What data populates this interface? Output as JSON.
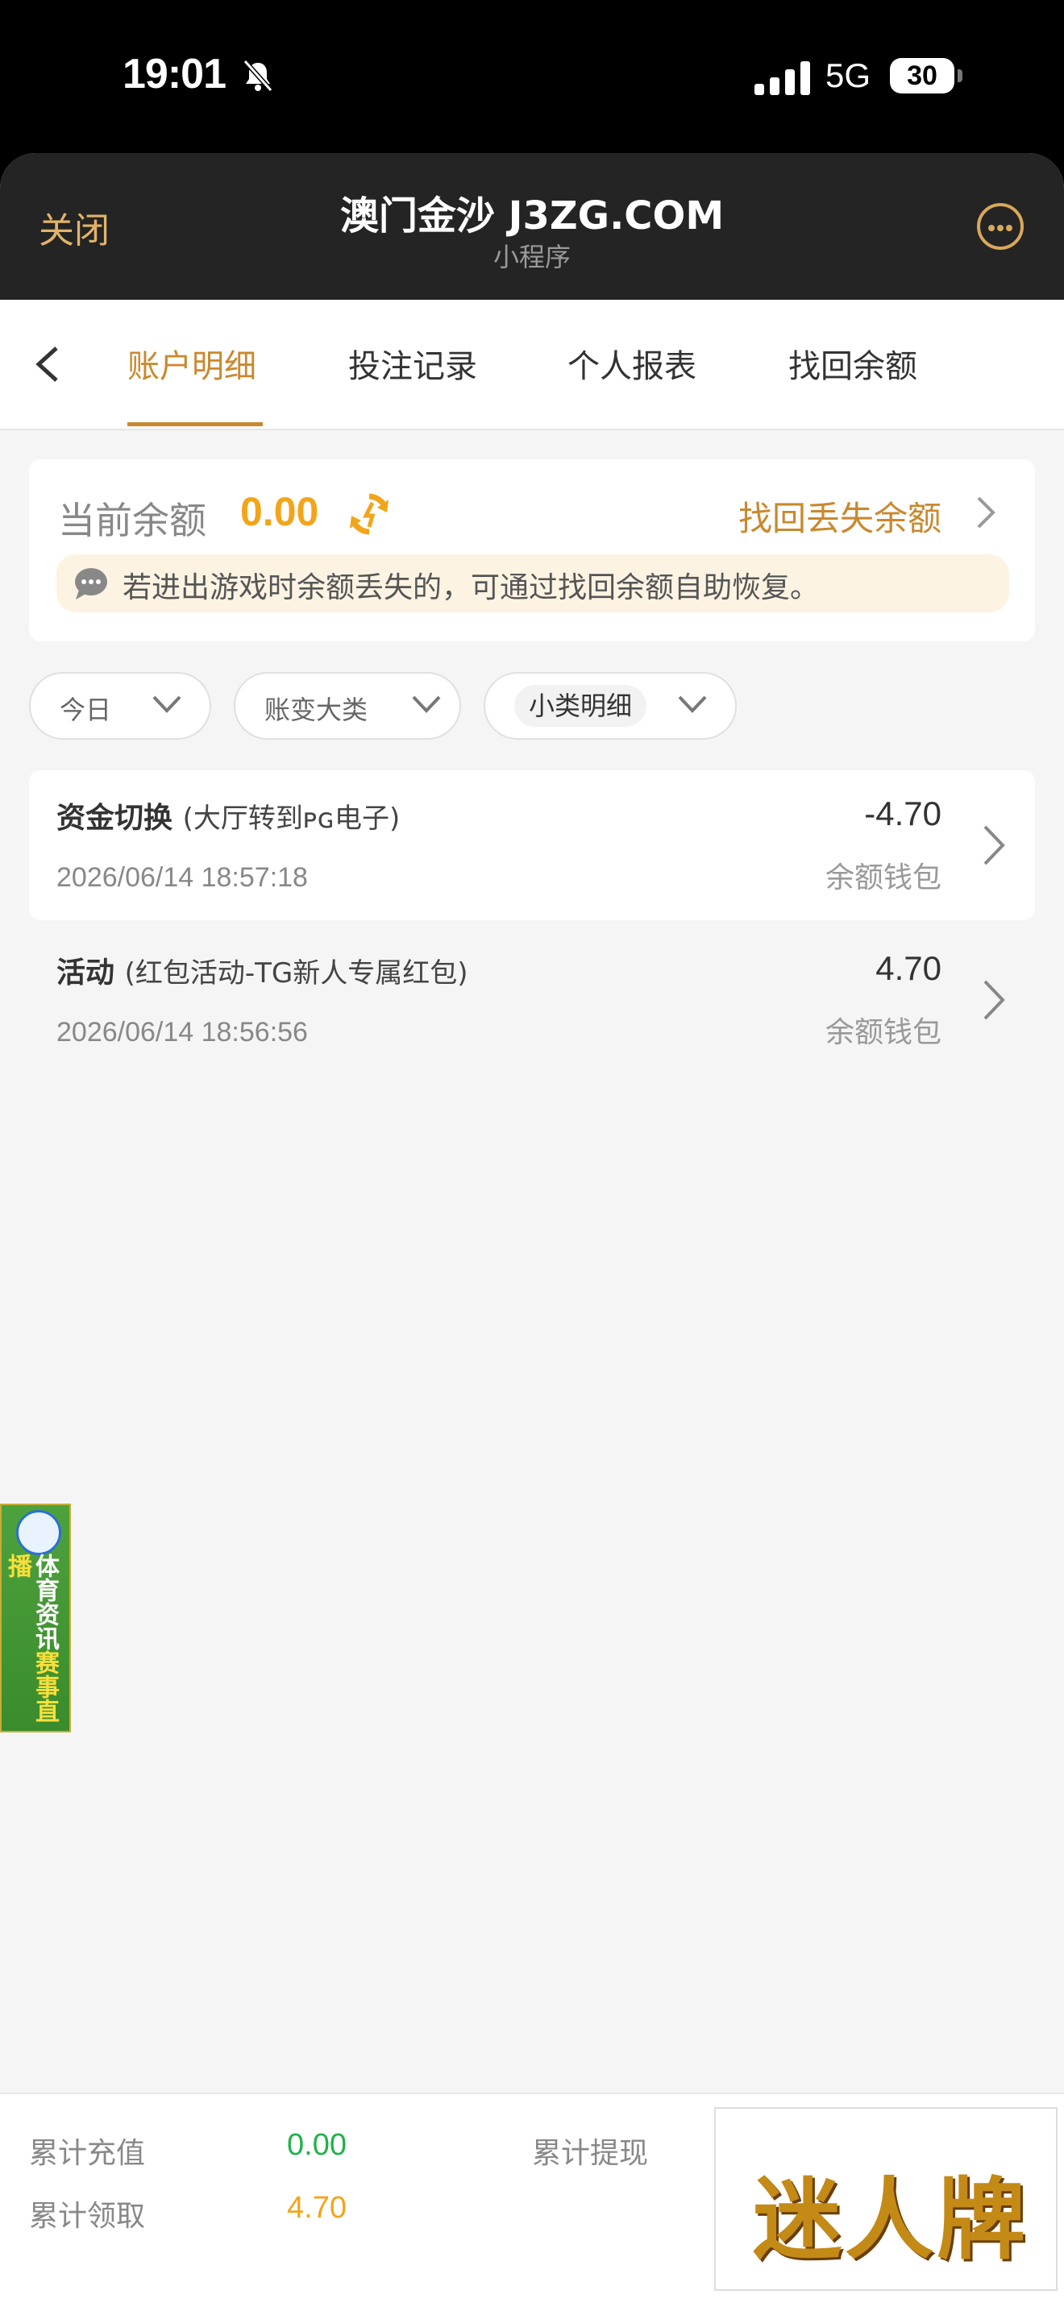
{
  "status_bar": {
    "time": "19:01",
    "network": "5G",
    "battery": "30"
  },
  "nav": {
    "close_label": "关闭",
    "title": "澳门金沙 J3ZG.COM",
    "subtitle": "小程序"
  },
  "tabs": [
    {
      "label": "账户明细"
    },
    {
      "label": "投注记录"
    },
    {
      "label": "个人报表"
    },
    {
      "label": "找回余额"
    }
  ],
  "balance": {
    "label": "当前余额",
    "amount": "0.00",
    "recover_link": "找回丢失余额",
    "tip": "若进出游戏时余额丢失的，可通过找回余额自助恢复。"
  },
  "filters": [
    {
      "label": "今日"
    },
    {
      "label": "账变大类"
    },
    {
      "label": "小类明细"
    }
  ],
  "transactions": [
    {
      "title": "资金切换",
      "detail": "(大厅转到ᴘɢ电子)",
      "amount": "-4.70",
      "wallet": "余额钱包",
      "time": "2026/06/14 18:57:18"
    },
    {
      "title": "活动",
      "detail": "(红包活动-TG新人专属红包)",
      "amount": "4.70",
      "wallet": "余额钱包",
      "time": "2026/06/14 18:56:56"
    }
  ],
  "promo": {
    "line1": "体育资讯",
    "line2": "赛事直播"
  },
  "footer": {
    "recharge_label": "累计充值",
    "recharge_value": "0.00",
    "withdraw_label": "累计提现",
    "claim_label": "累计领取",
    "claim_value": "4.70",
    "logo_text": "迷人牌"
  },
  "colors": {
    "accent": "#c9892e",
    "amount": "#f2a51a",
    "green": "#22b14c",
    "nav_bg": "#242424"
  }
}
